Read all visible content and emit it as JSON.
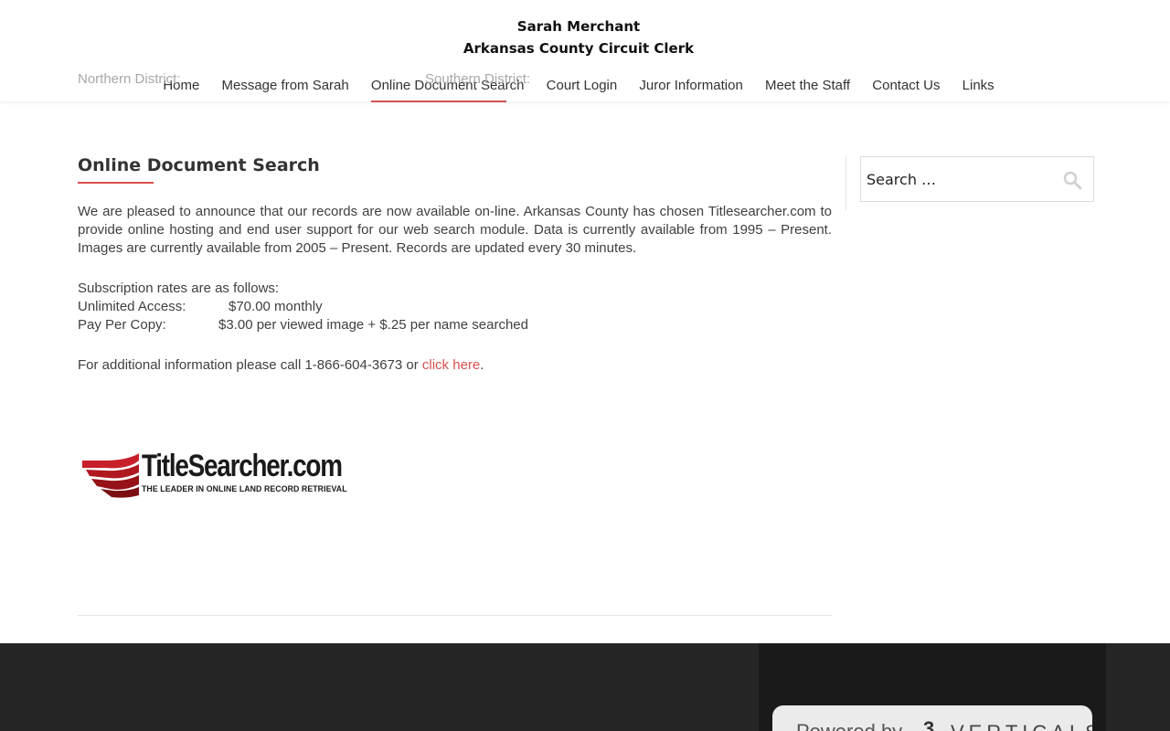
{
  "header": {
    "title_line1": "Sarah Merchant",
    "title_line2": "Arkansas County Circuit Clerk",
    "nav": [
      {
        "label": "Home"
      },
      {
        "label": "Message from Sarah"
      },
      {
        "label": "Online Document Search"
      },
      {
        "label": "Court Login"
      },
      {
        "label": "Juror Information"
      },
      {
        "label": "Meet the Staff"
      },
      {
        "label": "Contact Us"
      },
      {
        "label": "Links"
      }
    ]
  },
  "content": {
    "title": "Online Document Search",
    "intro": "We are pleased to announce that our records are now available on-line.  Arkansas County has chosen Titlesearcher.com to provide online hosting and end user support for our web search module.  Data is currently available from 1995 – Present.  Images are currently available from 2005 – Present.  Records are updated every 30 minutes.",
    "rates_heading": "Subscription rates are as follows:",
    "rate1_label": "Unlimited Access:",
    "rate1_value": "$70.00 monthly",
    "rate2_label": "Pay Per Copy:",
    "rate2_value": "$3.00 per viewed image + $.25 per name searched",
    "info_prefix": "For additional information please call 1-866-604-3673 or ",
    "info_link": "click here",
    "info_suffix": "."
  },
  "logo": {
    "name": "TitleSearcher.com",
    "tagline": "THE LEADER IN ONLINE LAND RECORD RETRIEVAL"
  },
  "sidebar": {
    "search_placeholder": "Search …"
  },
  "footer": {
    "northern": "Northern District:",
    "southern": "Southern District:",
    "powered_by": "Powered by",
    "powered_mark": "3",
    "powered_brand": "VERTICALS"
  },
  "colors": {
    "accent": "#d65050",
    "footer_bg": "#252525",
    "footer_dark": "#1a1a1a"
  },
  "icons": {
    "search": "search-icon",
    "logo": "titlesearcher-logo-swoosh-icon"
  }
}
